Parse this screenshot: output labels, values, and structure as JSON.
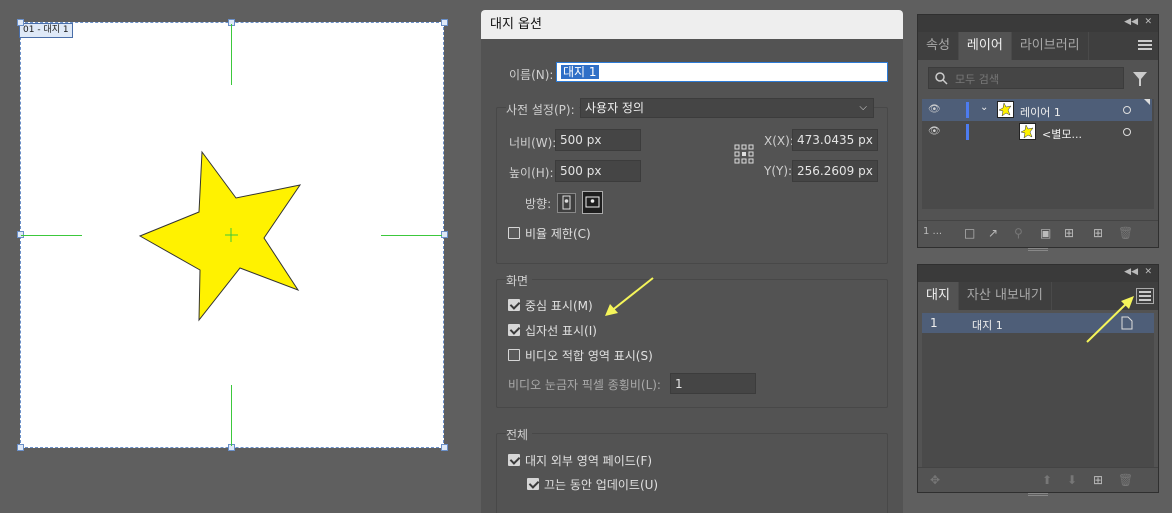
{
  "artboard": {
    "label": "01 - 대지 1"
  },
  "dialog": {
    "title": "대지 옵션",
    "name_label": "이름(N):",
    "name_value": "대지 1",
    "preset_label": "사전 설정(P):",
    "preset_value": "사용자 정의",
    "width_label": "너비(W):",
    "width_value": "500 px",
    "height_label": "높이(H):",
    "height_value": "500 px",
    "x_label": "X(X):",
    "x_value": "473.0435 px",
    "y_label": "Y(Y):",
    "y_value": "256.2609 px",
    "orientation_label": "방향:",
    "constrain_label": "비율 제한(C)",
    "constrain_checked": false,
    "display_section": "화면",
    "show_center_label": "중심 표시(M)",
    "show_center_checked": true,
    "show_cross_label": "십자선 표시(I)",
    "show_cross_checked": true,
    "show_video_label": "비디오 적합 영역 표시(S)",
    "show_video_checked": false,
    "video_ratio_label": "비디오 눈금자 픽셀 종횡비(L):",
    "video_ratio_value": "1",
    "global_section": "전체",
    "fade_label": "대지 외부 영역 페이드(F)",
    "fade_checked": true,
    "update_label": "끄는 동안 업데이트(U)",
    "update_checked": true
  },
  "layers_panel": {
    "tabs": [
      "속성",
      "레이어",
      "라이브러리"
    ],
    "active_tab": "레이어",
    "search_placeholder": "모두 검색",
    "layers": [
      {
        "name": "레이어 1",
        "expanded": true
      },
      {
        "name": "<별모...",
        "expanded": false
      }
    ],
    "count": "1 ..."
  },
  "artboards_panel": {
    "tabs": [
      "대지",
      "자산 내보내기"
    ],
    "active_tab": "대지",
    "rows": [
      {
        "index": "1",
        "name": "대지 1"
      }
    ]
  },
  "colors": {
    "star_fill": "#fff200",
    "guide": "#3cc83c",
    "selection": "#6a8fc8",
    "annotation_arrow": "#f5f55a"
  }
}
